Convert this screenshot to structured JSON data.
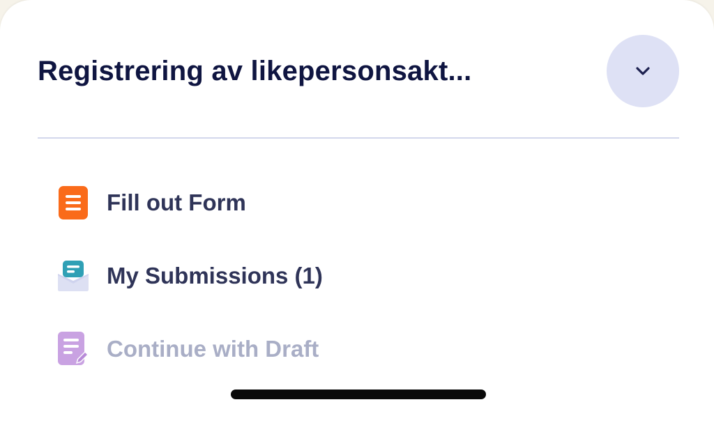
{
  "header": {
    "title": "Registrering av likepersonsakt...",
    "collapse_icon": "chevron-down-icon"
  },
  "menu": {
    "items": [
      {
        "label": "Fill out Form",
        "icon": "form-icon",
        "color": "#fa6b1a",
        "enabled": true
      },
      {
        "label": "My Submissions (1)",
        "icon": "submissions-envelope-icon",
        "color": "#2fa0b5",
        "enabled": true
      },
      {
        "label": "Continue with Draft",
        "icon": "draft-edit-icon",
        "color": "#c9a2e2",
        "enabled": false
      }
    ]
  },
  "colors": {
    "title": "#0f1541",
    "label": "#2f3458",
    "label_disabled": "#a9aec6",
    "collapse_bg": "#dee1f5",
    "divider": "#d3d7ec"
  }
}
